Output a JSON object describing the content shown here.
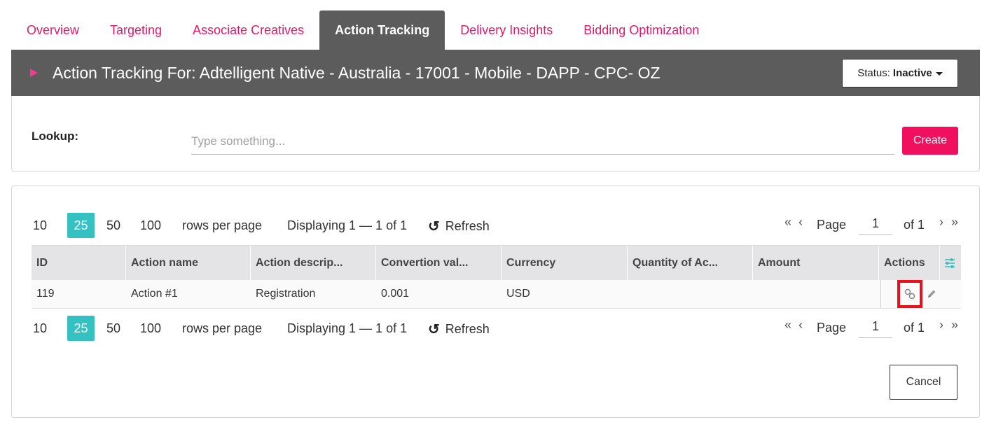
{
  "tabs": [
    {
      "label": "Overview",
      "active": false
    },
    {
      "label": "Targeting",
      "active": false
    },
    {
      "label": "Associate Creatives",
      "active": false
    },
    {
      "label": "Action Tracking",
      "active": true
    },
    {
      "label": "Delivery Insights",
      "active": false
    },
    {
      "label": "Bidding Optimization",
      "active": false
    }
  ],
  "header": {
    "title": "Action Tracking For: Adtelligent Native - Australia - 17001 - Mobile - DAPP - CPC- OZ",
    "status_label": "Status:",
    "status_value": "Inactive"
  },
  "lookup": {
    "label": "Lookup:",
    "placeholder": "Type something...",
    "value": "",
    "create_label": "Create"
  },
  "pager": {
    "sizes": [
      "10",
      "25",
      "50",
      "100"
    ],
    "active_size": "25",
    "rows_per_page": "rows per page",
    "displaying": "Displaying 1 — 1 of 1",
    "refresh": "Refresh",
    "first": "«",
    "prev": "‹",
    "next": "›",
    "last": "»",
    "page_label": "Page",
    "page_value": "1",
    "of_label": "of 1"
  },
  "table": {
    "columns": [
      "ID",
      "Action name",
      "Action descrip...",
      "Convertion val...",
      "Currency",
      "Quantity of Ac...",
      "Amount",
      "Actions"
    ],
    "rows": [
      {
        "id": "119",
        "name": "Action #1",
        "description": "Registration",
        "conversion": "0.001",
        "currency": "USD",
        "quantity": "",
        "amount": ""
      }
    ]
  },
  "icons": {
    "settings": "sliders-icon",
    "link": "link-icon",
    "edit": "pencil-icon",
    "refresh": "refresh-icon"
  },
  "colors": {
    "brand_pink": "#e5176c",
    "create_pink": "#f0105e",
    "teal": "#35c1c1",
    "header_gray": "#5c5c5c",
    "highlight_red": "#e8101a"
  },
  "footer": {
    "cancel_label": "Cancel"
  }
}
